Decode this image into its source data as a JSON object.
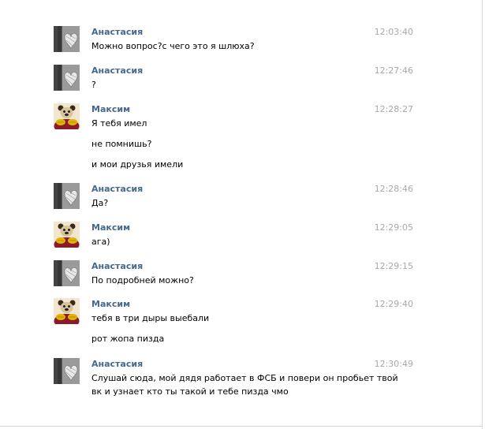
{
  "authors": {
    "anastasia": "Анастасия",
    "maksim": "Максим"
  },
  "messages": [
    {
      "author": "Анастасия",
      "time": "12:03:40",
      "lines": [
        "Можно вопрос?с чего это я шлюха?"
      ]
    },
    {
      "author": "Анастасия",
      "time": "12:27:46",
      "lines": [
        "?"
      ]
    },
    {
      "author": "Максим",
      "time": "12:28:27",
      "lines": [
        "Я тебя имел",
        "не помнишь?",
        "и мои друзья имели"
      ]
    },
    {
      "author": "Анастасия",
      "time": "12:28:46",
      "lines": [
        "Да?"
      ]
    },
    {
      "author": "Максим",
      "time": "12:29:05",
      "lines": [
        "ага)"
      ]
    },
    {
      "author": "Анастасия",
      "time": "12:29:15",
      "lines": [
        "По подробней можно?"
      ]
    },
    {
      "author": "Максим",
      "time": "12:29:40",
      "lines": [
        "тебя в три дыры выебали",
        "рот жопа пизда"
      ]
    },
    {
      "author": "Анастасия",
      "time": "12:30:49",
      "lines": [
        "Слушай сюда, мой дядя работает в ФСБ и повери он пробьет твой",
        "вк и узнает кто ты такой и тебе пизда чмо"
      ]
    }
  ],
  "colors": {
    "author_link": "#45688e",
    "timestamp": "#a9a9a9",
    "text": "#000000"
  },
  "icons": {
    "anastasia_avatar": "avatar-photo-grayscale-heart",
    "maksim_avatar": "avatar-photo-bear-cartoon"
  }
}
